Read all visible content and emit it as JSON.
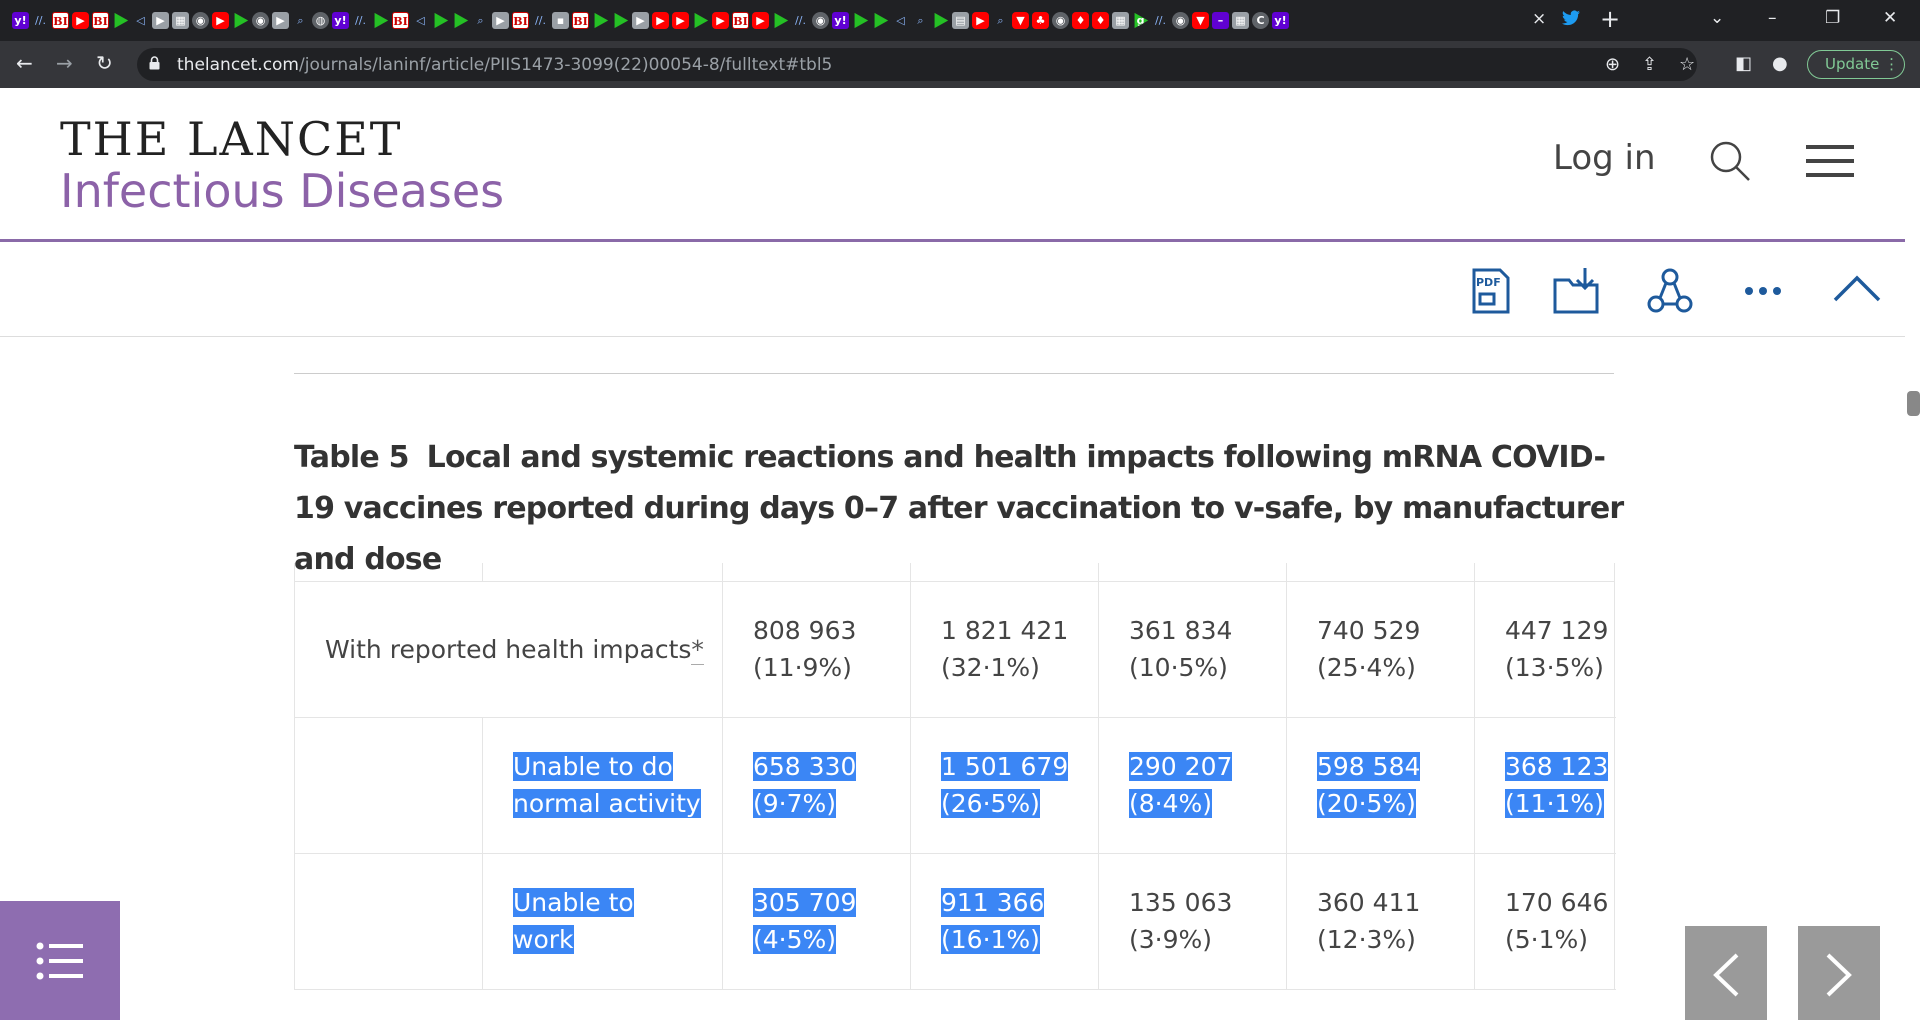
{
  "browser": {
    "url_host": "thelancet.com",
    "url_path": "/journals/laninf/article/PIIS1473-3099(22)00054-8/fulltext#tbl5",
    "update_label": "Update",
    "new_tab_symbol": "+",
    "close_symbol": "×"
  },
  "site": {
    "brand_top": "THE LANCET",
    "brand_bottom": "Infectious Diseases",
    "login_label": "Log in",
    "accent_color": "#8c62a8"
  },
  "toolbar": {
    "pdf_label": "PDF",
    "icons": [
      "pdf-icon",
      "download-folder-icon",
      "share-network-icon",
      "more-options-icon",
      "collapse-up-icon"
    ]
  },
  "table": {
    "number": "Table 5",
    "title": "Local and systemic reactions and health impacts following mRNA COVID-19 vaccines reported during days 0–7 after vaccination to v-safe, by manufacturer and dose",
    "rows": [
      {
        "label": "With reported health impacts",
        "footnote": "*",
        "values": [
          [
            "808 963",
            "(11·9%)"
          ],
          [
            "1 821 421",
            "(32·1%)"
          ],
          [
            "361 834",
            "(10·5%)"
          ],
          [
            "740 529",
            "(25·4%)"
          ],
          [
            "447 129",
            "(13·5%)"
          ]
        ]
      },
      {
        "label_line1": "Unable to do",
        "label_line2": "normal activity",
        "values": [
          [
            "658 330",
            "(9·7%)"
          ],
          [
            "1 501 679",
            "(26·5%)"
          ],
          [
            "290 207",
            "(8·4%)"
          ],
          [
            "598 584",
            "(20·5%)"
          ],
          [
            "368 123",
            "(11·1%)"
          ]
        ]
      },
      {
        "label_line1": "Unable to",
        "label_line2": "work",
        "values": [
          [
            "305 709",
            "(4·5%)"
          ],
          [
            "911 366",
            "(16·1%)"
          ],
          [
            "135 063",
            "(3·9%)"
          ],
          [
            "360 411",
            "(12·3%)"
          ],
          [
            "170 646",
            "(5·1%)"
          ]
        ]
      }
    ]
  },
  "nav": {
    "toc_icon": "table-of-contents-icon",
    "prev_icon": "chevron-left-icon",
    "next_icon": "chevron-right-icon"
  }
}
